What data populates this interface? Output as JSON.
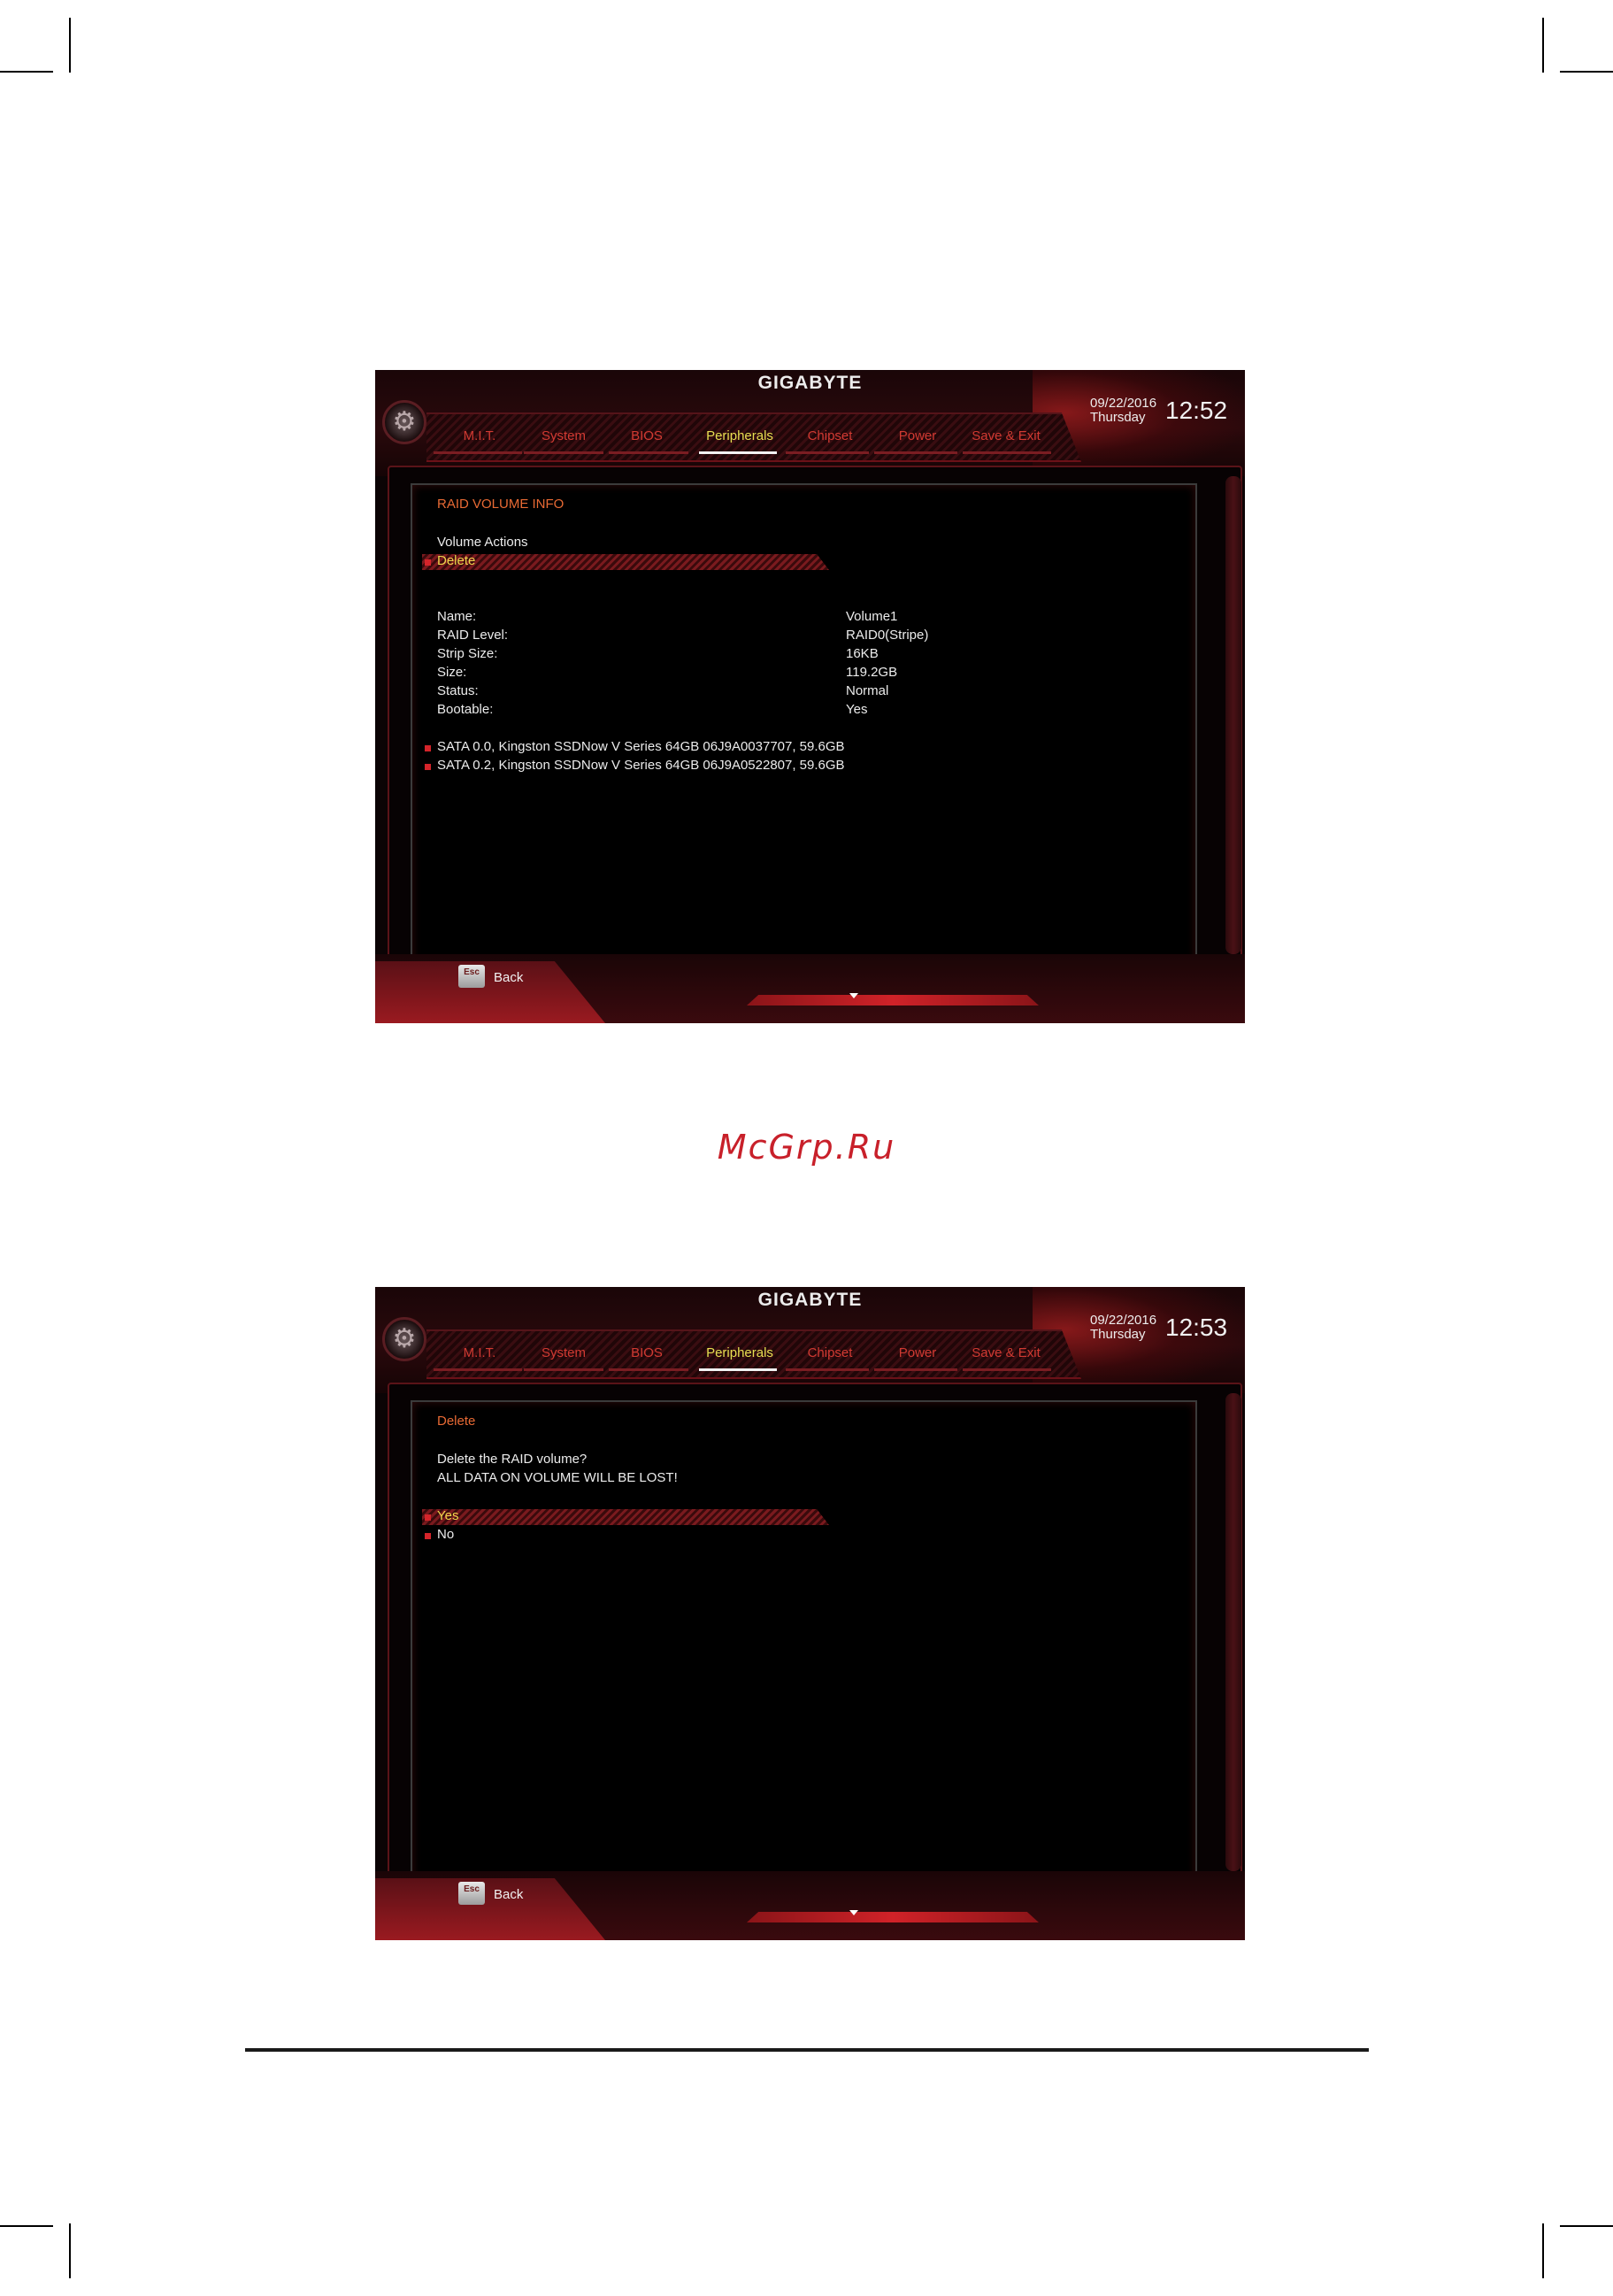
{
  "watermark": "McGrp.Ru",
  "screens": [
    {
      "brand": "GIGABYTE",
      "date": "09/22/2016",
      "day": "Thursday",
      "time": "12:52",
      "tabs": [
        "M.I.T.",
        "System",
        "BIOS",
        "Peripherals",
        "Chipset",
        "Power",
        "Save & Exit"
      ],
      "active_tab": "Peripherals",
      "section_title": "RAID VOLUME INFO",
      "actions_label": "Volume Actions",
      "selected_action": "Delete",
      "info": [
        {
          "label": "Name:",
          "value": "Volume1"
        },
        {
          "label": "RAID Level:",
          "value": "RAID0(Stripe)"
        },
        {
          "label": "Strip Size:",
          "value": "16KB"
        },
        {
          "label": "Size:",
          "value": "119.2GB"
        },
        {
          "label": "Status:",
          "value": "Normal"
        },
        {
          "label": "Bootable:",
          "value": "Yes"
        }
      ],
      "disks": [
        "SATA 0.0, Kingston SSDNow V Series 64GB 06J9A0037707, 59.6GB",
        "SATA 0.2, Kingston SSDNow V Series 64GB 06J9A0522807, 59.6GB"
      ],
      "esc_label": "Esc",
      "back_label": "Back"
    },
    {
      "brand": "GIGABYTE",
      "date": "09/22/2016",
      "day": "Thursday",
      "time": "12:53",
      "tabs": [
        "M.I.T.",
        "System",
        "BIOS",
        "Peripherals",
        "Chipset",
        "Power",
        "Save & Exit"
      ],
      "active_tab": "Peripherals",
      "section_title": "Delete",
      "prompt_line1": "Delete the RAID volume?",
      "prompt_line2": "ALL DATA ON VOLUME WILL BE LOST!",
      "options": [
        "Yes",
        "No"
      ],
      "selected_option": "Yes",
      "esc_label": "Esc",
      "back_label": "Back"
    }
  ]
}
